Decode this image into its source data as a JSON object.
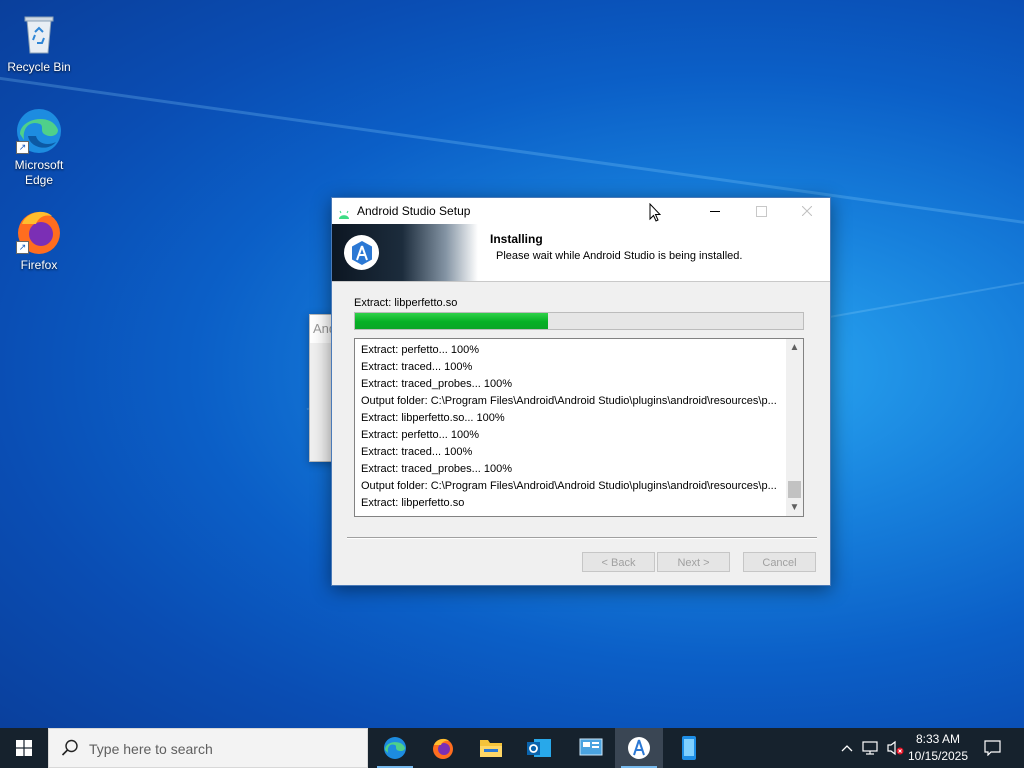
{
  "desktop": {
    "icons": [
      {
        "label": "Recycle Bin"
      },
      {
        "label": "Microsoft Edge"
      },
      {
        "label": "Firefox"
      }
    ]
  },
  "background_window": {
    "title_fragment": "And"
  },
  "setup_window": {
    "title": "Android Studio Setup",
    "header_title": "Installing",
    "header_subtitle": "Please wait while Android Studio is being installed.",
    "status_text": "Extract: libperfetto.so",
    "progress_fraction": 0.43,
    "log_lines": [
      "Extract: perfetto... 100%",
      "Extract: traced... 100%",
      "Extract: traced_probes... 100%",
      "Output folder: C:\\Program Files\\Android\\Android Studio\\plugins\\android\\resources\\p...",
      "Extract: libperfetto.so... 100%",
      "Extract: perfetto... 100%",
      "Extract: traced... 100%",
      "Extract: traced_probes... 100%",
      "Output folder: C:\\Program Files\\Android\\Android Studio\\plugins\\android\\resources\\p...",
      "Extract: libperfetto.so"
    ],
    "buttons": {
      "back": "< Back",
      "next": "Next >",
      "cancel": "Cancel"
    }
  },
  "taskbar": {
    "search_placeholder": "Type here to search",
    "apps": [
      "edge-icon",
      "firefox-icon",
      "file-explorer-icon",
      "outlook-icon",
      "control-panel-icon",
      "android-studio-setup-icon",
      "phone-icon"
    ],
    "time": "8:33 AM",
    "date": "10/15/2025"
  },
  "colors": {
    "accent": "#0078d7",
    "progress": "#06b025",
    "taskbar": "#16222d"
  }
}
